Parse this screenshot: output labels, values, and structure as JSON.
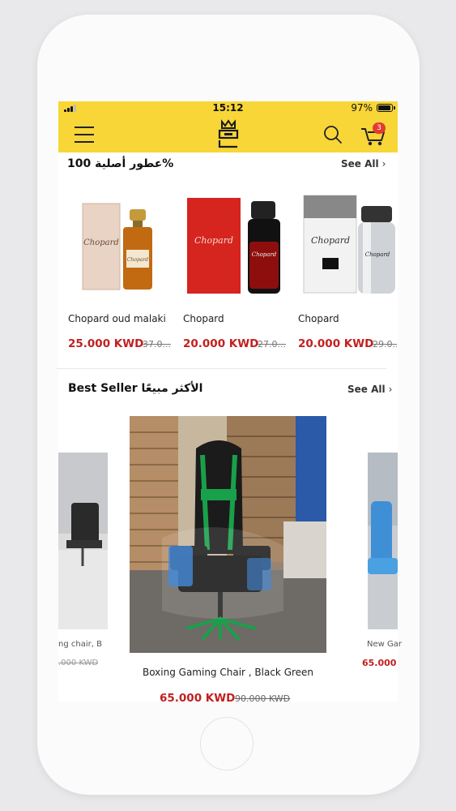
{
  "status_bar": {
    "time": "15:12",
    "battery": "97%"
  },
  "header": {
    "cart_count": "3"
  },
  "section1": {
    "title": "عطور أصلية 100%",
    "see_all": "See All",
    "products": [
      {
        "name": "Chopard oud malaki",
        "price": "25.000 KWD",
        "old_price": "37.0..."
      },
      {
        "name": "Chopard",
        "price": "20.000 KWD",
        "old_price": "27.0..."
      },
      {
        "name": "Chopard",
        "price": "20.000 KWD",
        "old_price": "29.0..."
      }
    ]
  },
  "section2": {
    "title": "Best Seller  الأكثر مبيعًا",
    "see_all": "See All",
    "left_product": {
      "name": "ng chair, B",
      "old_price": ".000 KWD"
    },
    "center_product": {
      "name": "Boxing Gaming Chair , Black Green",
      "price": "65.000 KWD",
      "old_price": "90.000 KWD"
    },
    "right_product": {
      "name": "New Gar",
      "price": "65.000 K"
    }
  }
}
